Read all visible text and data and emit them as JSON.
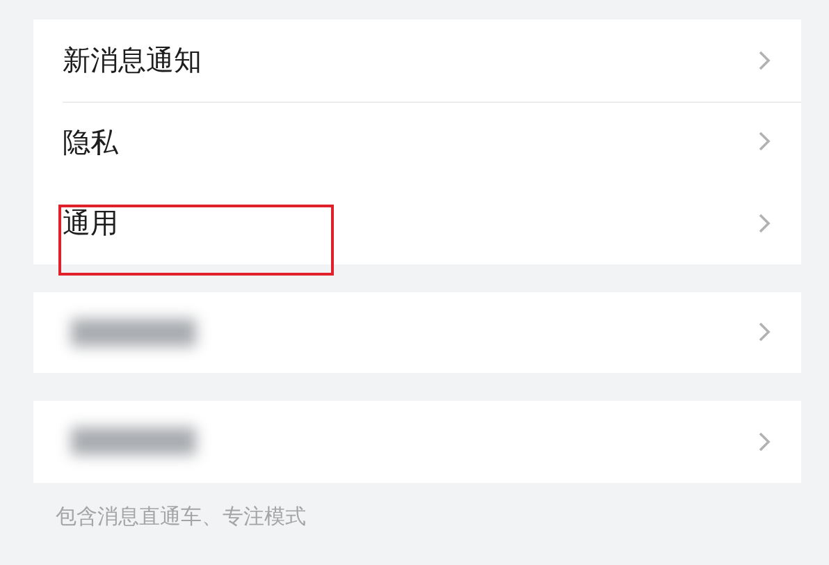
{
  "groups": [
    {
      "items": [
        {
          "kind": "text",
          "label": "新消息通知",
          "highlighted": false
        },
        {
          "kind": "text",
          "label": "隐私",
          "highlighted": false
        },
        {
          "kind": "text",
          "label": "通用",
          "highlighted": true
        }
      ]
    },
    {
      "items": [
        {
          "kind": "redacted",
          "highlighted": false
        }
      ]
    },
    {
      "items": [
        {
          "kind": "redacted",
          "highlighted": false
        }
      ]
    }
  ],
  "footnote": "包含消息直通车、专注模式"
}
